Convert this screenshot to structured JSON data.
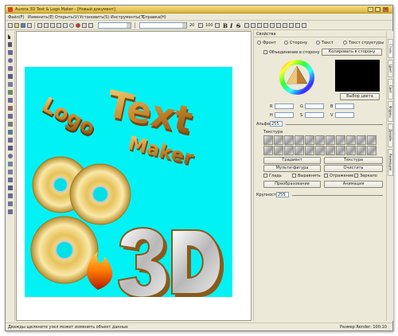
{
  "window": {
    "title": "Aurora 3D Text & Logo Maker - [Новый документ]",
    "min": "–",
    "max": "□",
    "close": "×"
  },
  "menu": [
    "Файл(F)",
    "Изменить(E)",
    "Открыть(V)",
    "Установить(S)",
    "Инструменты(T)",
    "Справка(H)"
  ],
  "toolbar": {
    "font_size": "20",
    "zoom": "100",
    "bold": "B",
    "italic": "I",
    "strike": "S"
  },
  "canvas": {
    "text_line1": "Logo",
    "text_line2": "Text",
    "text_line3": "Maker",
    "text_3d": "3D",
    "colors": {
      "background": "#00f2f4",
      "gold": "#c9882c",
      "chrome": "#d0d0d0"
    }
  },
  "panel": {
    "title": "Свойства",
    "radios": {
      "front": "Фронт",
      "side": "Сторону",
      "text": "Текст",
      "text_structure": "Текст структуры"
    },
    "unify_side": "Объединение в сторону",
    "copy_to_side": "Копировать в сторону",
    "pick_color": "Выбор цвета",
    "rgb": {
      "r": "R",
      "g": "G",
      "b": "B",
      "h": "H",
      "s": "S",
      "v": "V"
    },
    "alpha_label": "Альфа",
    "alpha_value": "255",
    "texture_label": "Текстура",
    "gradient": "Градиент",
    "texture": "Текстура",
    "multi_figure": "Мульти-фигура",
    "clear": "Очистить",
    "options": {
      "smooth": "Гладь",
      "align": "Выравнять",
      "reflection": "Отражение",
      "mirror": "Зеркало"
    },
    "transform": "Преобразование",
    "animation": "Анимация",
    "opacity_label": "Крупность",
    "opacity_value": "255"
  },
  "right_tabs": [
    "Стиль",
    "Цвет",
    "Свет",
    "Формы",
    "Дизайн",
    "Анимация"
  ],
  "status": {
    "left": "Дважды щелкните узел может изменить объект данных",
    "right": "Размер Render: 100:10"
  }
}
